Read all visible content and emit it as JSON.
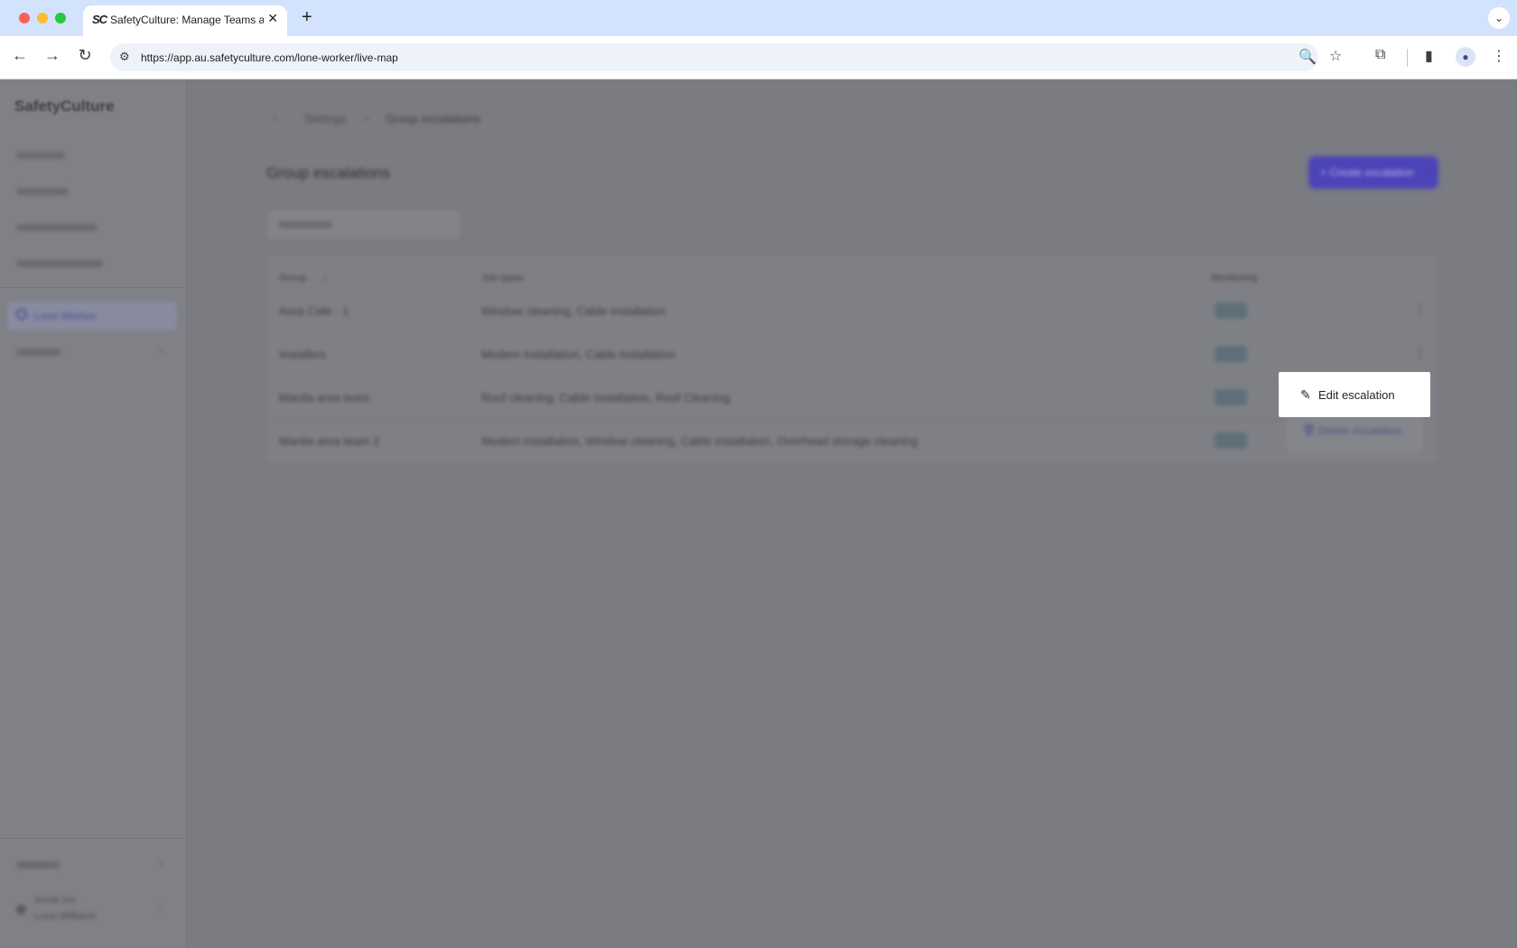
{
  "browser": {
    "tab_title": "SafetyCulture: Manage Teams and...",
    "tab_favicon": "SC",
    "tab_close": "✕",
    "new_tab": "+",
    "tab_menu": "⌄",
    "url": "https://app.au.safetyculture.com/lone-worker/live-map",
    "nav": {
      "back": "←",
      "forward": "→",
      "reload": "↻"
    },
    "icons": {
      "site_info": "⚙",
      "zoom": "🔍",
      "bookmark": "☆",
      "extensions": "⧉",
      "side_panel": "▮",
      "profile": "●",
      "menu": "⋮"
    }
  },
  "sidebar": {
    "brand": "SafetyCulture",
    "active_item": "Lone Worker",
    "org": "Acme Inc.",
    "user": "Luna Williams",
    "chevron": "›"
  },
  "main": {
    "breadcrumb": {
      "back": "‹",
      "settings": "Settings",
      "separator": "›",
      "current": "Group escalations"
    },
    "title": "Group escalations",
    "create_button": "+ Create escalation",
    "table": {
      "columns": {
        "group": "Group",
        "sort_arrow": "↓",
        "job_types": "Job types",
        "monitoring": "Monitoring"
      },
      "rows": [
        {
          "group": "Area Cafe - 1",
          "job_types": "Window cleaning, Cable installation"
        },
        {
          "group": "Installers",
          "job_types": "Modem installation, Cable installation"
        },
        {
          "group": "Manila area team",
          "job_types": "Roof cleaning, Cable installation, Roof Cleaning"
        },
        {
          "group": "Manila area team 2",
          "job_types": "Modem installation, Window cleaning, Cable installation, Overhead storage cleaning"
        }
      ],
      "kebab": "⋮"
    }
  },
  "menu": {
    "edit_label": "Edit escalation",
    "edit_icon": "✎",
    "delete_label": "Delete escalation",
    "delete_icon": "🗑"
  }
}
